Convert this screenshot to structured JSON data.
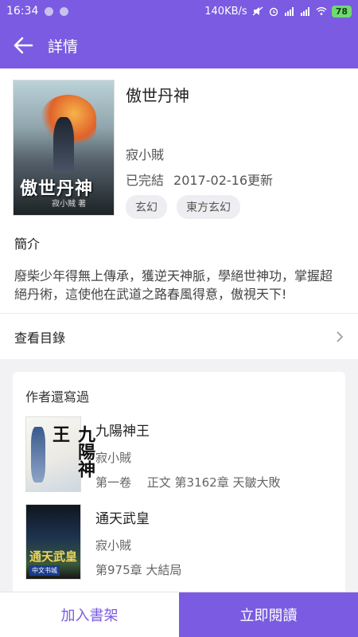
{
  "status_bar": {
    "time": "16:34",
    "network_speed": "140KB/s",
    "battery": "78"
  },
  "app_bar": {
    "title": "詳情",
    "back_icon": "arrow-left-icon"
  },
  "book": {
    "title": "傲世丹神",
    "author": "寂小賊",
    "status": "已完結",
    "update": "2017-02-16更新",
    "tags": [
      "玄幻",
      "東方玄幻"
    ],
    "cover_title": "傲世丹神",
    "cover_author": "寂小贼 著"
  },
  "intro": {
    "title": "簡介",
    "text": "廢柴少年得無上傳承，獲逆天神脈，學絕世神功，掌握超絕丹術，這使他在武道之路春風得意，傲視天下!"
  },
  "toc": {
    "label": "查看目錄"
  },
  "author_books": {
    "title": "作者還寫過",
    "items": [
      {
        "title": "九陽神王",
        "author": "寂小賊",
        "chapter": "第一卷　 正文 第3162章 天皺大敗",
        "cover_title": "九陽神王"
      },
      {
        "title": "通天武皇",
        "author": "寂小賊",
        "chapter": "第975章 大結局",
        "cover_title": "通天武皇",
        "cover_publisher": "中文书城"
      }
    ]
  },
  "bottom_bar": {
    "add_shelf": "加入書架",
    "read_now": "立即閱讀"
  }
}
